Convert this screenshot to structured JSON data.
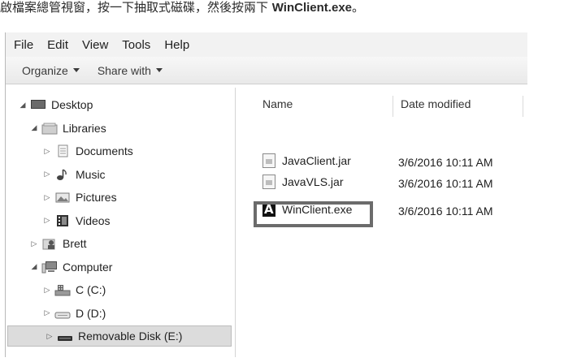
{
  "caption": {
    "text": "啟檔案總管視窗，按一下抽取式磁碟，然後按兩下 ",
    "bold": "WinClient.exe",
    "end": "。"
  },
  "menubar": {
    "items": [
      "File",
      "Edit",
      "View",
      "Tools",
      "Help"
    ]
  },
  "toolbar": {
    "organize": "Organize",
    "share_with": "Share with"
  },
  "nav": {
    "items": [
      {
        "label": "Desktop",
        "icon": "desktop-icon",
        "arrow": "◢",
        "level": 0
      },
      {
        "label": "Libraries",
        "icon": "libraries-icon",
        "arrow": "◢",
        "level": 1
      },
      {
        "label": "Documents",
        "icon": "documents-icon",
        "arrow": "▷",
        "level": 2
      },
      {
        "label": "Music",
        "icon": "music-icon",
        "arrow": "▷",
        "level": 2
      },
      {
        "label": "Pictures",
        "icon": "pictures-icon",
        "arrow": "▷",
        "level": 2
      },
      {
        "label": "Videos",
        "icon": "videos-icon",
        "arrow": "▷",
        "level": 2
      },
      {
        "label": "Brett",
        "icon": "user-folder-icon",
        "arrow": "▷",
        "level": 1
      },
      {
        "label": "Computer",
        "icon": "computer-icon",
        "arrow": "◢",
        "level": 1
      },
      {
        "label": "C (C:)",
        "icon": "drive-c-icon",
        "arrow": "▷",
        "level": 2
      },
      {
        "label": "D (D:)",
        "icon": "drive-d-icon",
        "arrow": "▷",
        "level": 2
      },
      {
        "label": "Removable Disk (E:)",
        "icon": "removable-disk-icon",
        "arrow": "▷",
        "level": 2
      }
    ]
  },
  "columns": {
    "name": "Name",
    "date_modified": "Date modified"
  },
  "files": [
    {
      "name": "JavaClient.jar",
      "date": "3/6/2016 10:11 AM",
      "icon": "jar-file-icon"
    },
    {
      "name": "JavaVLS.jar",
      "date": "3/6/2016 10:11 AM",
      "icon": "jar-file-icon"
    },
    {
      "name": "WinClient.exe",
      "date": "3/6/2016 10:11 AM",
      "icon": "exe-file-icon"
    }
  ],
  "colors": {
    "selected_row": "#dcdcdc",
    "highlight_border": "#6b6b6b"
  }
}
